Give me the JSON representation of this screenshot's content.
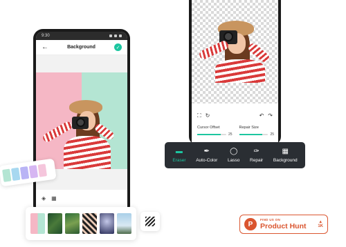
{
  "left_phone": {
    "status_time": "9:30",
    "header": {
      "title": "Background",
      "back_icon": "arrow-left-icon",
      "confirm_icon": "check-circle-icon"
    },
    "canvas_colors": [
      "#f5b7c5",
      "#b4e5d3"
    ],
    "bottom_tools": [
      "fill-icon",
      "pattern-icon"
    ]
  },
  "color_swatches": [
    "#b4e5d3",
    "#a7d8f0",
    "#b9b4f5",
    "#d6b6f2",
    "#f5c6dc"
  ],
  "background_options": [
    {
      "name": "pink-mint-split"
    },
    {
      "name": "green-leaves"
    },
    {
      "name": "green-plants"
    },
    {
      "name": "diagonal-stripes"
    },
    {
      "name": "purple-sky"
    },
    {
      "name": "mountain-landscape"
    }
  ],
  "right_phone": {
    "sliders": [
      {
        "label": "Cursor Offset",
        "value": "25",
        "fraction": 0.8
      },
      {
        "label": "Repair Size",
        "value": "25",
        "fraction": 0.8
      }
    ]
  },
  "toolbar": {
    "items": [
      {
        "label": "Eraser",
        "icon": "eraser-icon",
        "active": true
      },
      {
        "label": "Auto-Color",
        "icon": "dropper-icon",
        "active": false
      },
      {
        "label": "Lasso",
        "icon": "lasso-icon",
        "active": false
      },
      {
        "label": "Repair",
        "icon": "brush-icon",
        "active": false
      },
      {
        "label": "Background",
        "icon": "stripes-icon",
        "active": false
      }
    ]
  },
  "product_hunt": {
    "small_text": "FIND US ON",
    "big_text": "Product Hunt",
    "logo_letter": "P",
    "votes": "1K",
    "accent": "#da552f"
  },
  "accent_color": "#1cc6a0"
}
